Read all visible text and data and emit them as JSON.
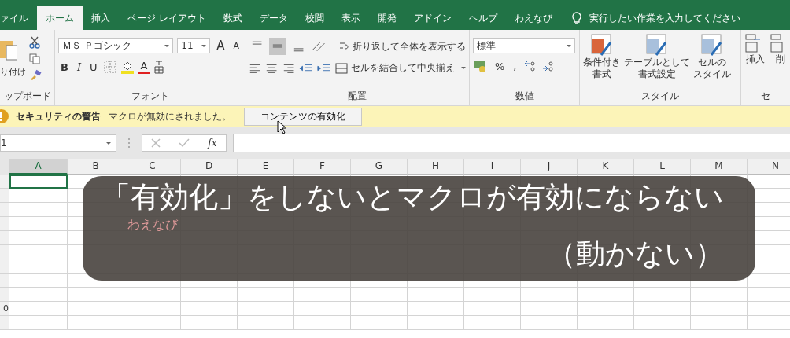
{
  "tabs": [
    {
      "label": "ァイル",
      "selected": false
    },
    {
      "label": "ホーム",
      "selected": true
    },
    {
      "label": "挿入",
      "selected": false
    },
    {
      "label": "ページ レイアウト",
      "selected": false
    },
    {
      "label": "数式",
      "selected": false
    },
    {
      "label": "データ",
      "selected": false
    },
    {
      "label": "校閲",
      "selected": false
    },
    {
      "label": "表示",
      "selected": false
    },
    {
      "label": "開発",
      "selected": false
    },
    {
      "label": "アドイン",
      "selected": false
    },
    {
      "label": "ヘルプ",
      "selected": false
    },
    {
      "label": "わえなび",
      "selected": false
    }
  ],
  "tell_me": {
    "placeholder": "実行したい作業を入力してください"
  },
  "ribbon": {
    "clipboard": {
      "paste": "り付け",
      "label": "ップボード"
    },
    "font": {
      "font_name": "ＭＳ Ｐゴシック",
      "font_size": "11",
      "grow": "A",
      "shrink": "A",
      "bold": "B",
      "italic": "I",
      "underline": "U",
      "font_color": "A",
      "label": "フォント"
    },
    "alignment": {
      "vertical": [
        {
          "kind": "top",
          "selected": false
        },
        {
          "kind": "middle",
          "selected": true
        },
        {
          "kind": "bottom",
          "selected": false
        }
      ],
      "wrap_text": "折り返して全体を表示する",
      "merge_center": "セルを結合して中央揃え",
      "label": "配置"
    },
    "number": {
      "format": "標準",
      "percent": "%",
      "comma": ",",
      "label": "数値"
    },
    "styles": {
      "buttons": [
        {
          "line1": "条件付き",
          "line2": "書式"
        },
        {
          "line1": "テーブルとして",
          "line2": "書式設定"
        },
        {
          "line1": "セルの",
          "line2": "スタイル"
        }
      ],
      "label": "スタイル"
    },
    "cells": {
      "insert": "挿入",
      "delete": "削",
      "label": "セ"
    }
  },
  "security_bar": {
    "title": "セキュリティの警告",
    "message": "マクロが無効にされました。",
    "button": "コンテンツの有効化"
  },
  "formula_bar": {
    "name_box": "1",
    "fx": "fx"
  },
  "grid": {
    "columns": [
      {
        "label": "A",
        "selected": true
      },
      {
        "label": "B",
        "selected": false
      },
      {
        "label": "C",
        "selected": false
      },
      {
        "label": "D",
        "selected": false
      },
      {
        "label": "E",
        "selected": false
      },
      {
        "label": "F",
        "selected": false
      },
      {
        "label": "G",
        "selected": false
      },
      {
        "label": "H",
        "selected": false
      },
      {
        "label": "I",
        "selected": false
      },
      {
        "label": "J",
        "selected": false
      },
      {
        "label": "K",
        "selected": false
      },
      {
        "label": "L",
        "selected": false
      },
      {
        "label": "M",
        "selected": false
      },
      {
        "label": "N",
        "selected": false
      }
    ],
    "cut_row_label": "0",
    "cell_text": "わえなび"
  },
  "caption": {
    "lines": [
      "「有効化」をしないとマクロが有効にならない",
      "（動かない）"
    ]
  }
}
